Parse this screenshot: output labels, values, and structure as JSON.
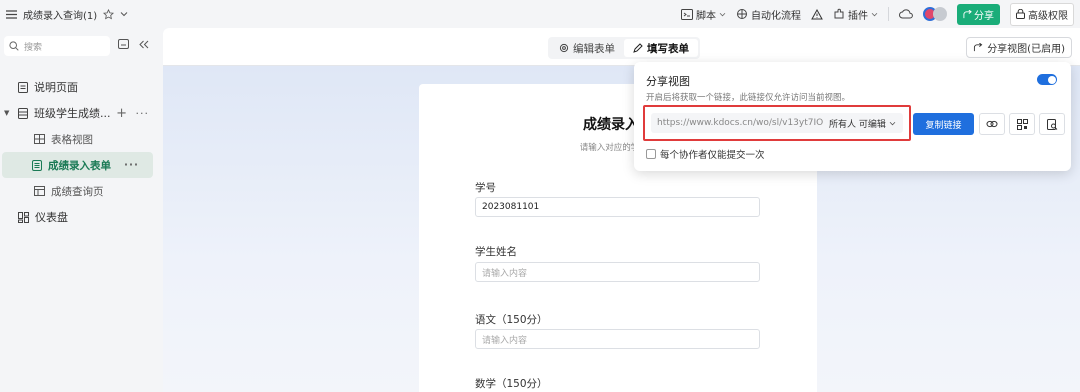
{
  "topbar": {
    "doc_title": "成绩录入查询(1)",
    "script_label": "脚本",
    "automation_label": "自动化流程",
    "plugin_label": "插件",
    "share_label": "分享",
    "permission_label": "高级权限"
  },
  "sidebar": {
    "search_placeholder": "搜索",
    "items": [
      {
        "label": "说明页面"
      },
      {
        "label": "班级学生成绩..."
      },
      {
        "label": "表格视图"
      },
      {
        "label": "成绩录入表单"
      },
      {
        "label": "成绩查询页"
      },
      {
        "label": "仪表盘"
      }
    ]
  },
  "main": {
    "tabs": [
      {
        "label": "编辑表单"
      },
      {
        "label": "填写表单"
      }
    ],
    "share_view_label": "分享视图(已启用)"
  },
  "form": {
    "title": "成绩录入表",
    "subtitle": "请输入对应的学号和",
    "fields": [
      {
        "label": "学号",
        "value": "2023081101"
      },
      {
        "label": "学生姓名",
        "placeholder": "请输入内容"
      },
      {
        "label": "语文（150分）",
        "placeholder": "请输入内容"
      },
      {
        "label": "数学（150分）"
      }
    ]
  },
  "share_popup": {
    "title": "分享视图",
    "description": "开启后将获取一个链接，此链接仅允许访问当前视图。",
    "toggle_on": true,
    "link": "https://www.kdocs.cn/wo/sl/v13yt7IO",
    "permission": "所有人 可编辑",
    "copy_label": "复制链接",
    "checkbox_label": "每个协作者仅能提交一次"
  },
  "colors": {
    "accent_green": "#1aad79",
    "accent_blue": "#1f6fde",
    "highlight_red": "#e03b3b"
  }
}
